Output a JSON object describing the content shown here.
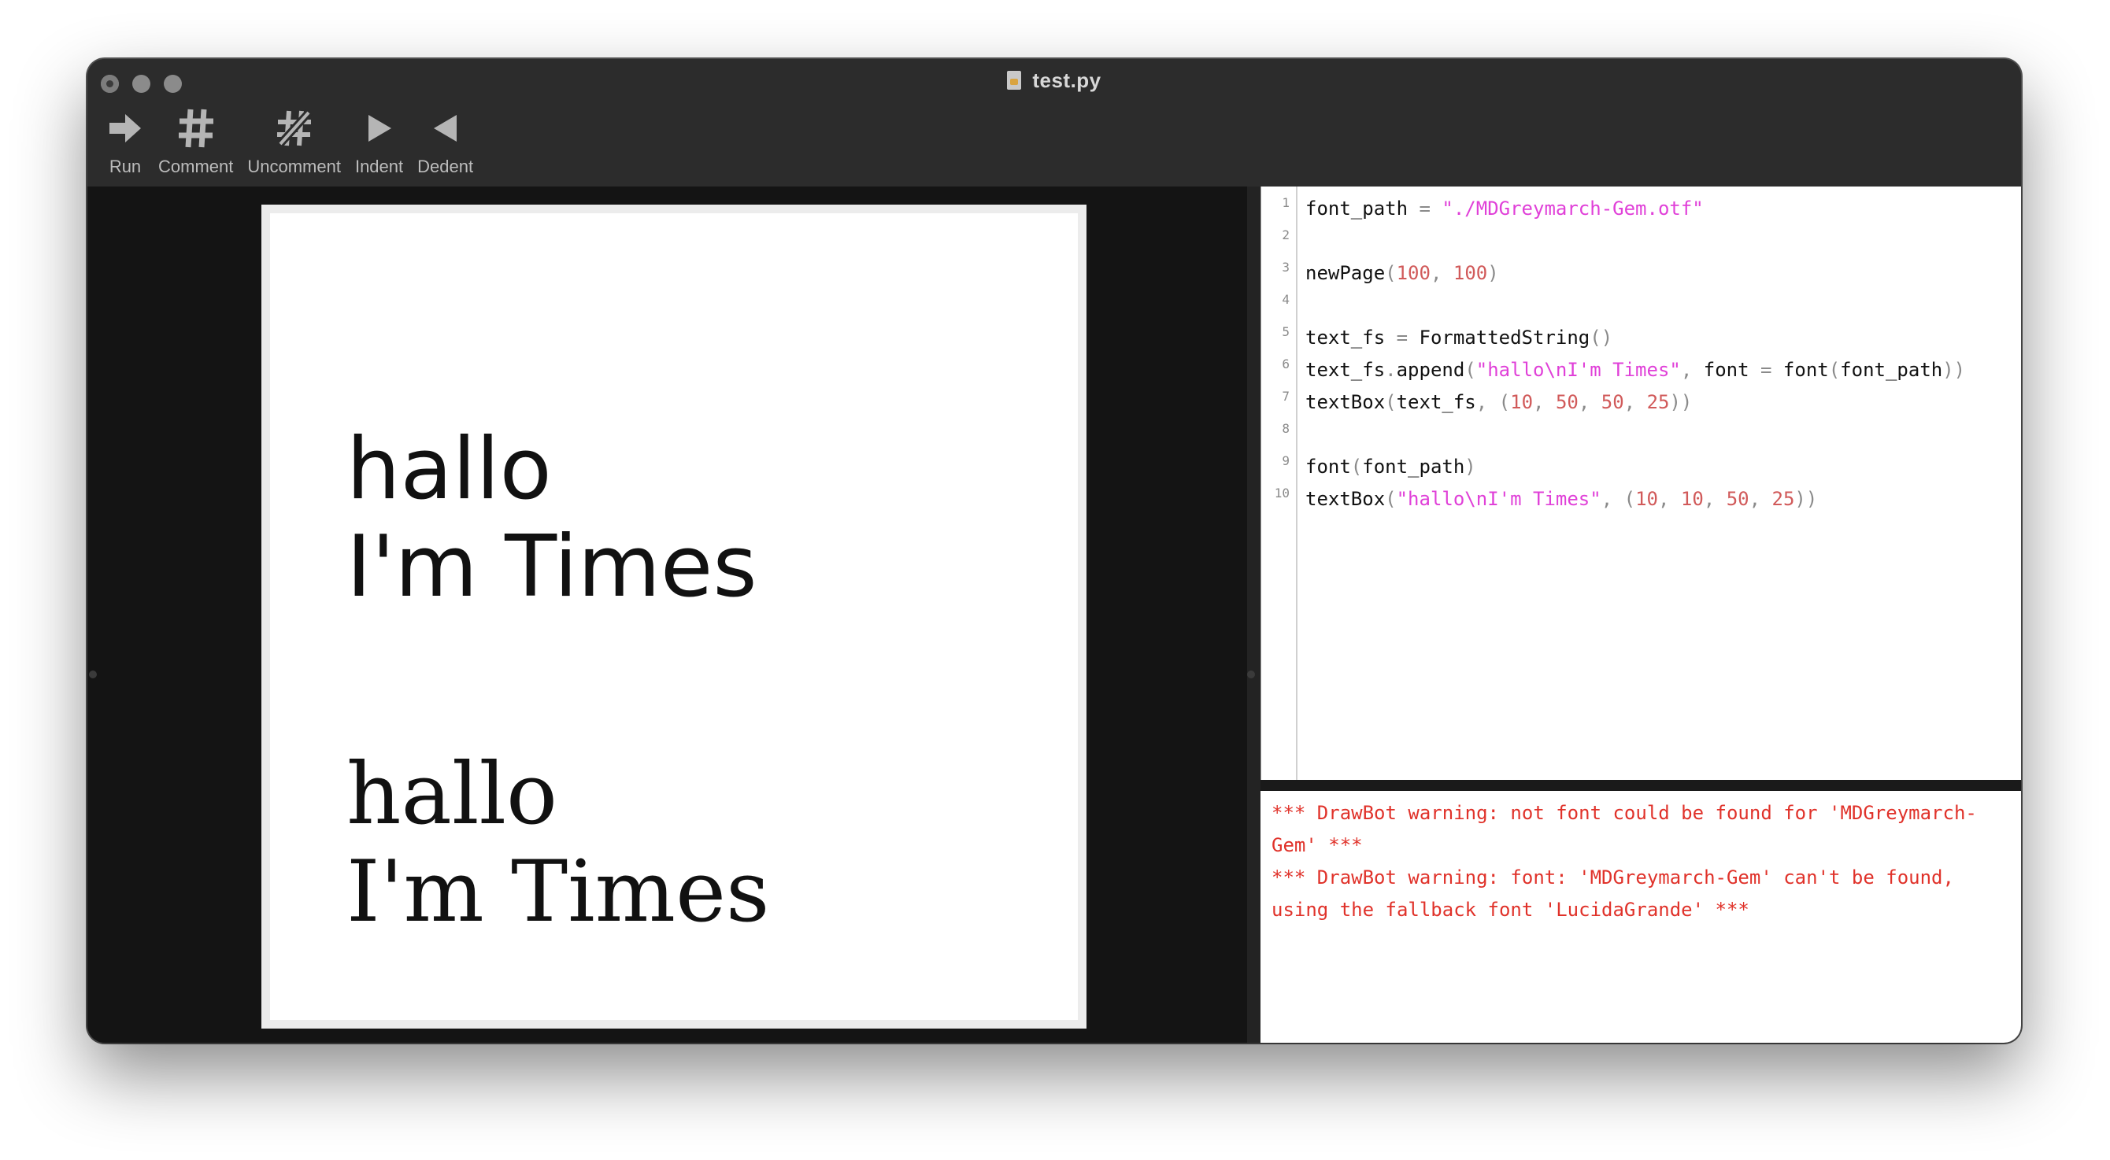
{
  "window": {
    "title": "test.py"
  },
  "toolbar": {
    "items": [
      {
        "label": "Run",
        "icon": "arrow-right-icon"
      },
      {
        "label": "Comment",
        "icon": "hash-icon"
      },
      {
        "label": "Uncomment",
        "icon": "hash-strike-icon"
      },
      {
        "label": "Indent",
        "icon": "triangle-right-icon"
      },
      {
        "label": "Dedent",
        "icon": "triangle-left-icon"
      }
    ]
  },
  "canvas": {
    "block1": {
      "line1": "hallo",
      "line2": "I'm Times"
    },
    "block2": {
      "line1": "hallo",
      "line2": "I'm Times"
    }
  },
  "editor": {
    "lines": [
      {
        "num": "1",
        "text": "font_path = \"./MDGreymarch-Gem.otf\""
      },
      {
        "num": "2",
        "text": ""
      },
      {
        "num": "3",
        "text": "newPage(100, 100)"
      },
      {
        "num": "4",
        "text": ""
      },
      {
        "num": "5",
        "text": "text_fs = FormattedString()"
      },
      {
        "num": "6",
        "text": "text_fs.append(\"hallo\\nI'm Times\", font = font(font_path))"
      },
      {
        "num": "7",
        "text": "textBox(text_fs, (10, 50, 50, 25))"
      },
      {
        "num": "8",
        "text": ""
      },
      {
        "num": "9",
        "text": "font(font_path)"
      },
      {
        "num": "10",
        "text": "textBox(\"hallo\\nI'm Times\", (10, 10, 50, 25))"
      }
    ]
  },
  "console": {
    "lines": [
      "*** DrawBot warning: not font could be found for 'MDGreymarch-Gem' ***",
      "*** DrawBot warning: font: 'MDGreymarch-Gem' can't be found, using the fallback font 'LucidaGrande' ***"
    ]
  },
  "colors": {
    "string": "#e040d8",
    "number": "#d15a5a",
    "warning": "#e0322a",
    "window_bg": "#232323",
    "canvas_bg": "#141414"
  }
}
